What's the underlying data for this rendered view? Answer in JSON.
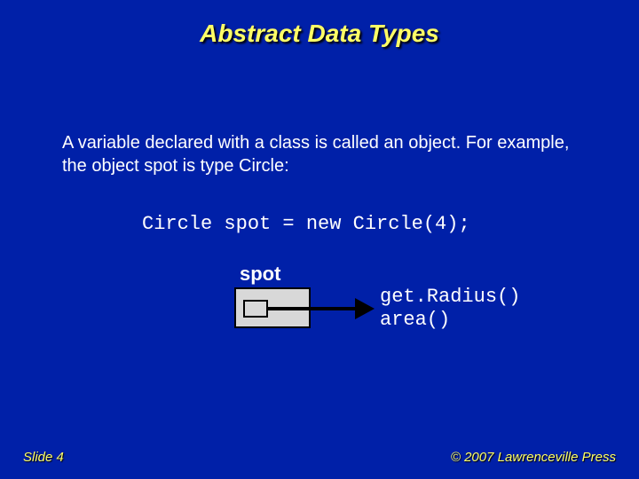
{
  "title": "Abstract Data Types",
  "body": "A variable declared with a class is called an object. For example, the object spot is type Circle:",
  "code": "Circle spot = new Circle(4);",
  "diagram": {
    "label": "spot",
    "method1": "get.Radius()",
    "method2": "area()"
  },
  "footer": {
    "slide": "Slide 4",
    "copyright": "© 2007 Lawrenceville Press"
  }
}
